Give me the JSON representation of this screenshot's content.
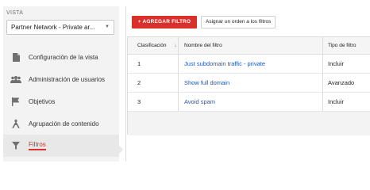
{
  "sidebar": {
    "vista_label": "VISTA",
    "vista_selected": "Partner Network - Private ar...",
    "items": [
      {
        "label": "Configuración de la vista",
        "icon": "document-icon"
      },
      {
        "label": "Administración de usuarios",
        "icon": "users-icon"
      },
      {
        "label": "Objetivos",
        "icon": "flag-icon"
      },
      {
        "label": "Agrupación de contenido",
        "icon": "person-tree-icon"
      },
      {
        "label": "Filtros",
        "icon": "filter-icon",
        "active": true
      }
    ]
  },
  "toolbar": {
    "add_filter_label": "+ AGREGAR FILTRO",
    "assign_order_label": "Asignar un orden a los filtros"
  },
  "table": {
    "columns": [
      "Clasificación",
      "Nombre del filtro",
      "Tipo de filtro"
    ],
    "sort_indicator": "↓",
    "rows": [
      {
        "rank": "1",
        "name": "Just subdomain traffic - private",
        "type": "Incluir"
      },
      {
        "rank": "2",
        "name": "Show full domain",
        "type": "Avanzado"
      },
      {
        "rank": "3",
        "name": "Avoid spam",
        "type": "Incluir"
      }
    ]
  },
  "colors": {
    "accent": "#d9302c",
    "link": "#1a56c4"
  }
}
